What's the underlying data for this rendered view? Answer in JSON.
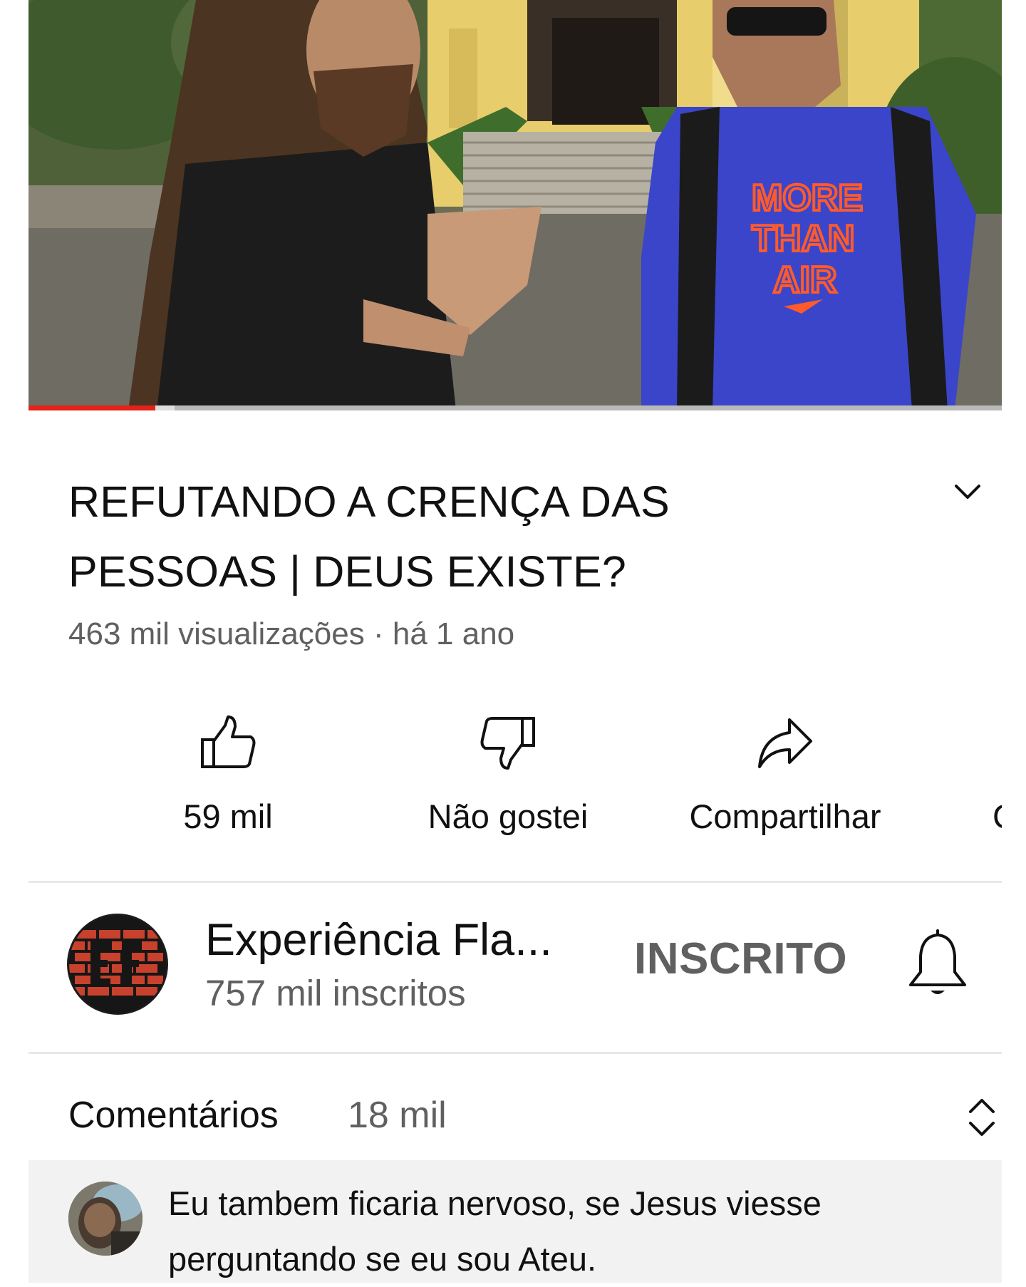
{
  "video": {
    "shirt_text": [
      "MORE",
      "THAN",
      "AIR"
    ],
    "progress": 0.13,
    "buffered": 0.15
  },
  "title": "REFUTANDO A CRENÇA DAS PESSOAS | DEUS EXISTE?",
  "meta": {
    "views": "463 mil visualizações",
    "separator": " · ",
    "age": "há 1 ano"
  },
  "actions": {
    "like": {
      "label": "59 mil",
      "icon": "thumbs-up-icon"
    },
    "dislike": {
      "label": "Não gostei",
      "icon": "thumbs-down-icon"
    },
    "share": {
      "label": "Compartilhar",
      "icon": "share-arrow-icon"
    },
    "partial": {
      "label": "C"
    }
  },
  "channel": {
    "name": "Experiência Fla...",
    "subscribers": "757 mil inscritos",
    "subscribe_label": "INSCRITO",
    "bell_icon": "bell-icon"
  },
  "comments": {
    "title": "Comentários",
    "count": "18 mil",
    "sort_icon": "expand-collapse-icon",
    "top_comment": {
      "text": "Eu tambem ficaria nervoso, se Jesus viesse perguntando se eu sou Ateu."
    }
  },
  "colors": {
    "progress_red": "#e62117",
    "secondary_text": "#606060",
    "shirt_blue": "#3b45c9",
    "shirt_print": "#ff5a2a"
  }
}
